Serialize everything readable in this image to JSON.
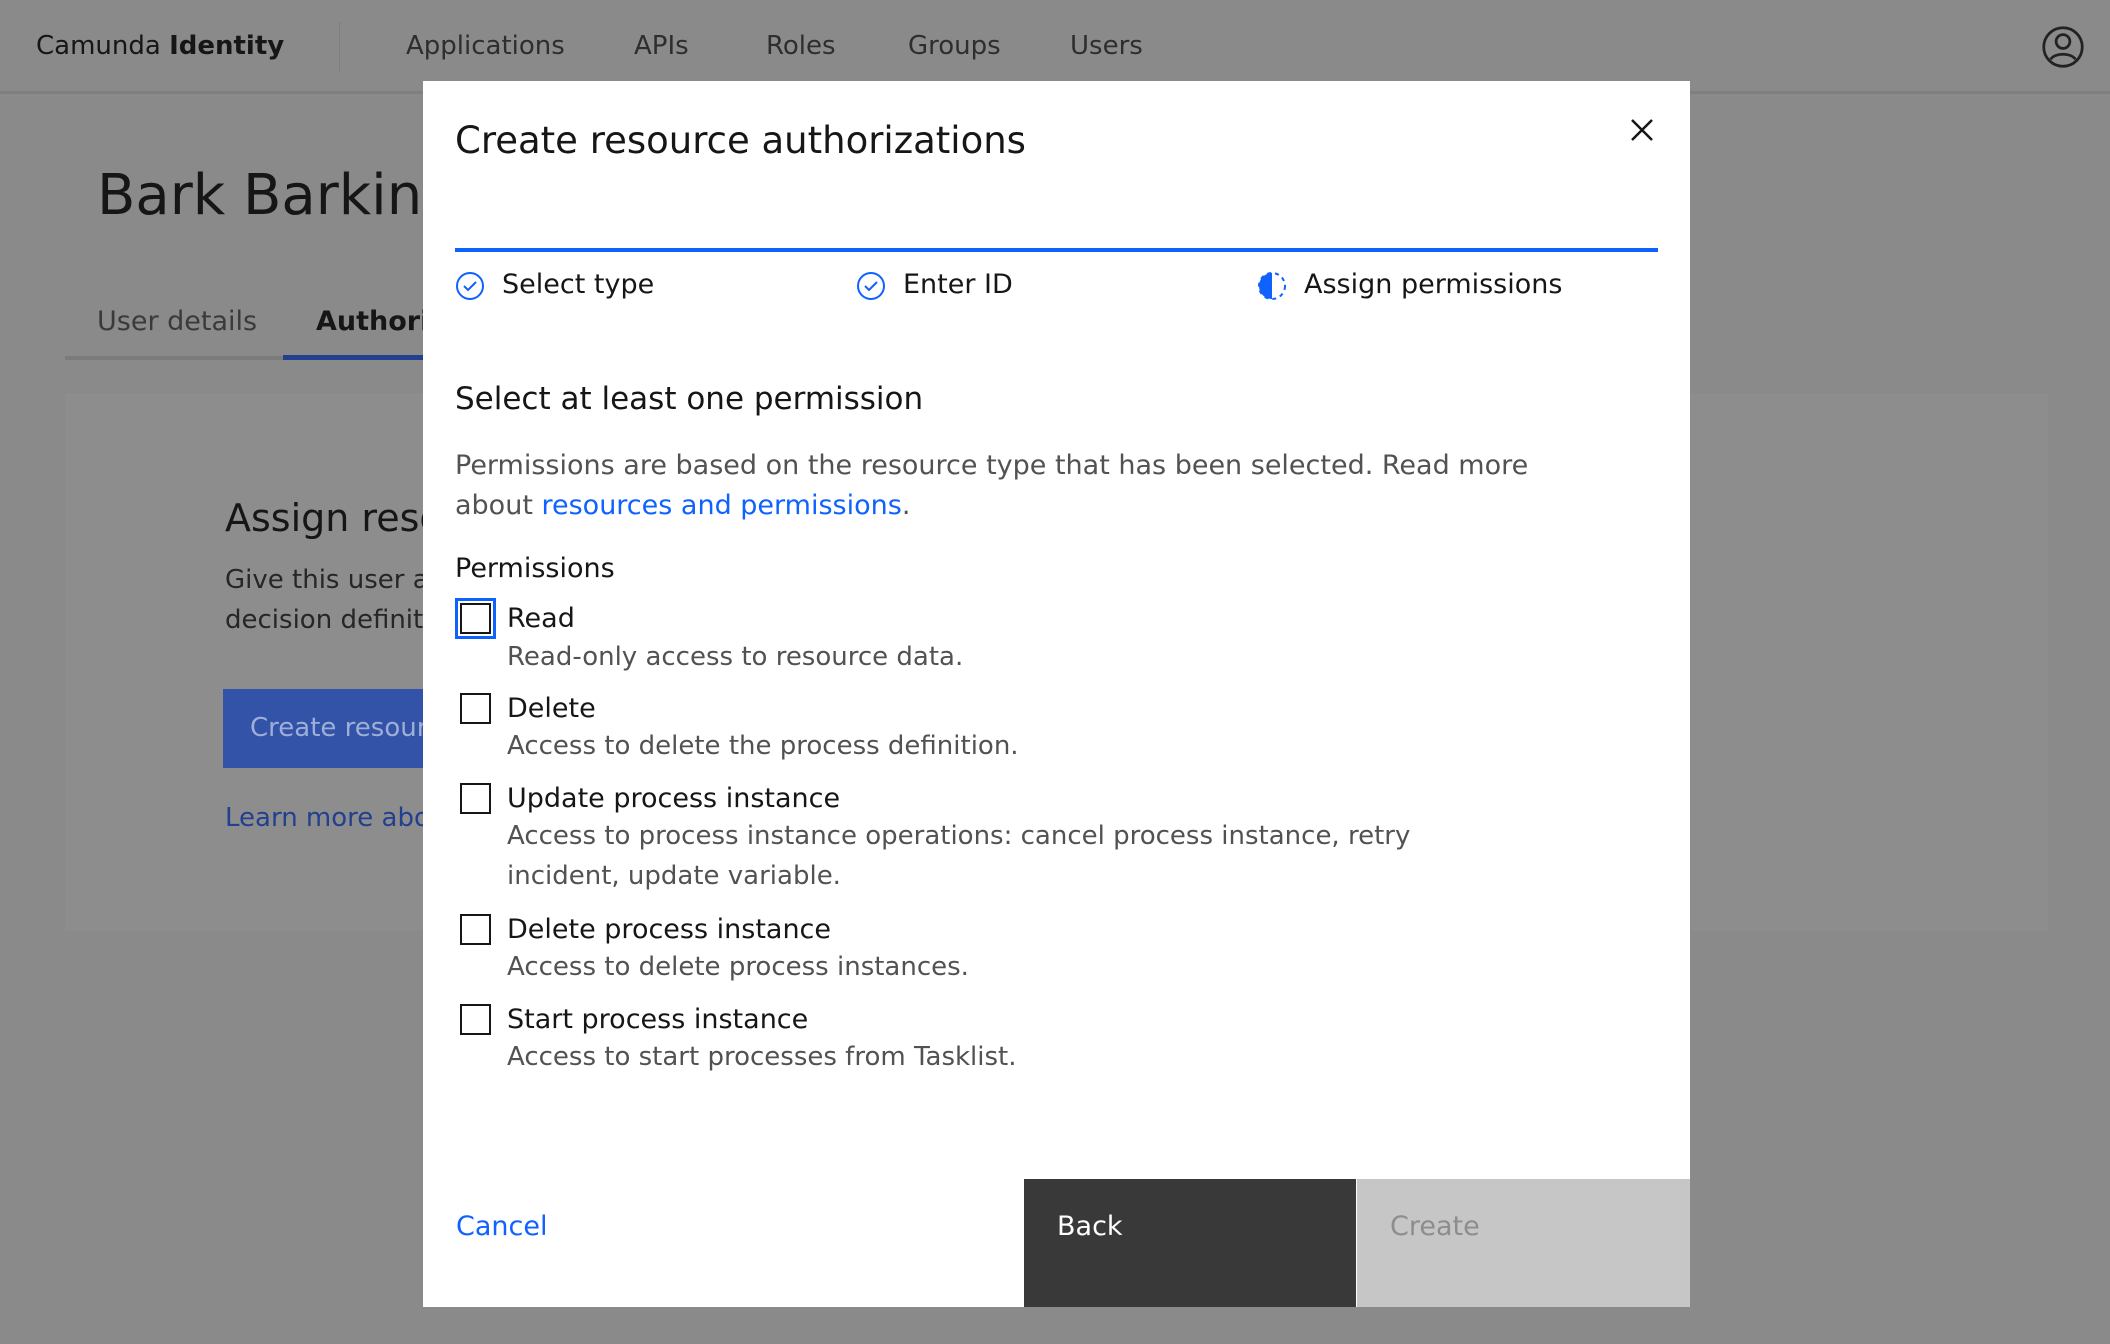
{
  "header": {
    "brand_prefix": "Camunda",
    "brand_bold": "Identity",
    "nav": [
      "Applications",
      "APIs",
      "Roles",
      "Groups",
      "Users"
    ]
  },
  "page": {
    "title": "Bark Barkins",
    "tabs": [
      "User details",
      "Authoriz"
    ],
    "card_heading": "Assign reso",
    "card_text": [
      "Give this user a",
      "decision definit"
    ],
    "card_button": "Create resour",
    "card_link": "Learn more abo"
  },
  "modal": {
    "title": "Create resource authorizations",
    "steps": [
      {
        "label": "Select type",
        "state": "complete"
      },
      {
        "label": "Enter ID",
        "state": "complete"
      },
      {
        "label": "Assign permissions",
        "state": "current"
      }
    ],
    "progress_percent": 100,
    "section_title": "Select at least one permission",
    "description_text": "Permissions are based on the resource type that has been selected. Read more",
    "description_about": "about ",
    "description_link": "resources and permissions",
    "description_end": ".",
    "permissions_label": "Permissions",
    "permissions": [
      {
        "label": "Read",
        "description": "Read-only access to resource data.",
        "checked": false,
        "focused": true
      },
      {
        "label": "Delete",
        "description": "Access to delete the process definition.",
        "checked": false
      },
      {
        "label": "Update process instance",
        "description": "Access to process instance operations: cancel process instance, retry",
        "description2": "incident, update variable.",
        "checked": false
      },
      {
        "label": "Delete process instance",
        "description": "Access to delete process instances.",
        "checked": false
      },
      {
        "label": "Start process instance",
        "description": "Access to start processes from Tasklist.",
        "checked": false
      }
    ],
    "cancel": "Cancel",
    "back": "Back",
    "create": "Create"
  },
  "colors": {
    "accent": "#0f62fe",
    "overlay": "#8a8a8a",
    "back_button": "#393939",
    "disabled": "#c6c6c6"
  }
}
